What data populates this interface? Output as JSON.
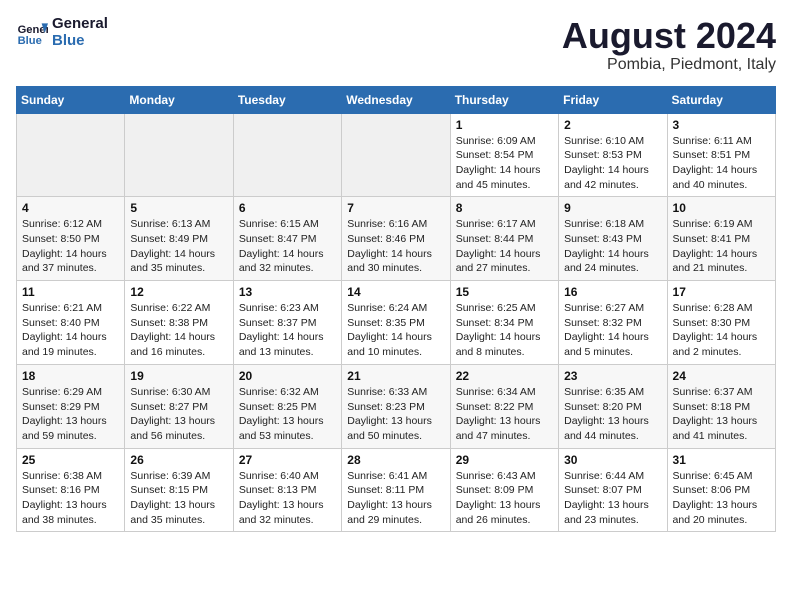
{
  "logo": {
    "line1": "General",
    "line2": "Blue"
  },
  "title": "August 2024",
  "location": "Pombia, Piedmont, Italy",
  "days_of_week": [
    "Sunday",
    "Monday",
    "Tuesday",
    "Wednesday",
    "Thursday",
    "Friday",
    "Saturday"
  ],
  "weeks": [
    [
      {
        "day": "",
        "info": ""
      },
      {
        "day": "",
        "info": ""
      },
      {
        "day": "",
        "info": ""
      },
      {
        "day": "",
        "info": ""
      },
      {
        "day": "1",
        "info": "Sunrise: 6:09 AM\nSunset: 8:54 PM\nDaylight: 14 hours and 45 minutes."
      },
      {
        "day": "2",
        "info": "Sunrise: 6:10 AM\nSunset: 8:53 PM\nDaylight: 14 hours and 42 minutes."
      },
      {
        "day": "3",
        "info": "Sunrise: 6:11 AM\nSunset: 8:51 PM\nDaylight: 14 hours and 40 minutes."
      }
    ],
    [
      {
        "day": "4",
        "info": "Sunrise: 6:12 AM\nSunset: 8:50 PM\nDaylight: 14 hours and 37 minutes."
      },
      {
        "day": "5",
        "info": "Sunrise: 6:13 AM\nSunset: 8:49 PM\nDaylight: 14 hours and 35 minutes."
      },
      {
        "day": "6",
        "info": "Sunrise: 6:15 AM\nSunset: 8:47 PM\nDaylight: 14 hours and 32 minutes."
      },
      {
        "day": "7",
        "info": "Sunrise: 6:16 AM\nSunset: 8:46 PM\nDaylight: 14 hours and 30 minutes."
      },
      {
        "day": "8",
        "info": "Sunrise: 6:17 AM\nSunset: 8:44 PM\nDaylight: 14 hours and 27 minutes."
      },
      {
        "day": "9",
        "info": "Sunrise: 6:18 AM\nSunset: 8:43 PM\nDaylight: 14 hours and 24 minutes."
      },
      {
        "day": "10",
        "info": "Sunrise: 6:19 AM\nSunset: 8:41 PM\nDaylight: 14 hours and 21 minutes."
      }
    ],
    [
      {
        "day": "11",
        "info": "Sunrise: 6:21 AM\nSunset: 8:40 PM\nDaylight: 14 hours and 19 minutes."
      },
      {
        "day": "12",
        "info": "Sunrise: 6:22 AM\nSunset: 8:38 PM\nDaylight: 14 hours and 16 minutes."
      },
      {
        "day": "13",
        "info": "Sunrise: 6:23 AM\nSunset: 8:37 PM\nDaylight: 14 hours and 13 minutes."
      },
      {
        "day": "14",
        "info": "Sunrise: 6:24 AM\nSunset: 8:35 PM\nDaylight: 14 hours and 10 minutes."
      },
      {
        "day": "15",
        "info": "Sunrise: 6:25 AM\nSunset: 8:34 PM\nDaylight: 14 hours and 8 minutes."
      },
      {
        "day": "16",
        "info": "Sunrise: 6:27 AM\nSunset: 8:32 PM\nDaylight: 14 hours and 5 minutes."
      },
      {
        "day": "17",
        "info": "Sunrise: 6:28 AM\nSunset: 8:30 PM\nDaylight: 14 hours and 2 minutes."
      }
    ],
    [
      {
        "day": "18",
        "info": "Sunrise: 6:29 AM\nSunset: 8:29 PM\nDaylight: 13 hours and 59 minutes."
      },
      {
        "day": "19",
        "info": "Sunrise: 6:30 AM\nSunset: 8:27 PM\nDaylight: 13 hours and 56 minutes."
      },
      {
        "day": "20",
        "info": "Sunrise: 6:32 AM\nSunset: 8:25 PM\nDaylight: 13 hours and 53 minutes."
      },
      {
        "day": "21",
        "info": "Sunrise: 6:33 AM\nSunset: 8:23 PM\nDaylight: 13 hours and 50 minutes."
      },
      {
        "day": "22",
        "info": "Sunrise: 6:34 AM\nSunset: 8:22 PM\nDaylight: 13 hours and 47 minutes."
      },
      {
        "day": "23",
        "info": "Sunrise: 6:35 AM\nSunset: 8:20 PM\nDaylight: 13 hours and 44 minutes."
      },
      {
        "day": "24",
        "info": "Sunrise: 6:37 AM\nSunset: 8:18 PM\nDaylight: 13 hours and 41 minutes."
      }
    ],
    [
      {
        "day": "25",
        "info": "Sunrise: 6:38 AM\nSunset: 8:16 PM\nDaylight: 13 hours and 38 minutes."
      },
      {
        "day": "26",
        "info": "Sunrise: 6:39 AM\nSunset: 8:15 PM\nDaylight: 13 hours and 35 minutes."
      },
      {
        "day": "27",
        "info": "Sunrise: 6:40 AM\nSunset: 8:13 PM\nDaylight: 13 hours and 32 minutes."
      },
      {
        "day": "28",
        "info": "Sunrise: 6:41 AM\nSunset: 8:11 PM\nDaylight: 13 hours and 29 minutes."
      },
      {
        "day": "29",
        "info": "Sunrise: 6:43 AM\nSunset: 8:09 PM\nDaylight: 13 hours and 26 minutes."
      },
      {
        "day": "30",
        "info": "Sunrise: 6:44 AM\nSunset: 8:07 PM\nDaylight: 13 hours and 23 minutes."
      },
      {
        "day": "31",
        "info": "Sunrise: 6:45 AM\nSunset: 8:06 PM\nDaylight: 13 hours and 20 minutes."
      }
    ]
  ]
}
